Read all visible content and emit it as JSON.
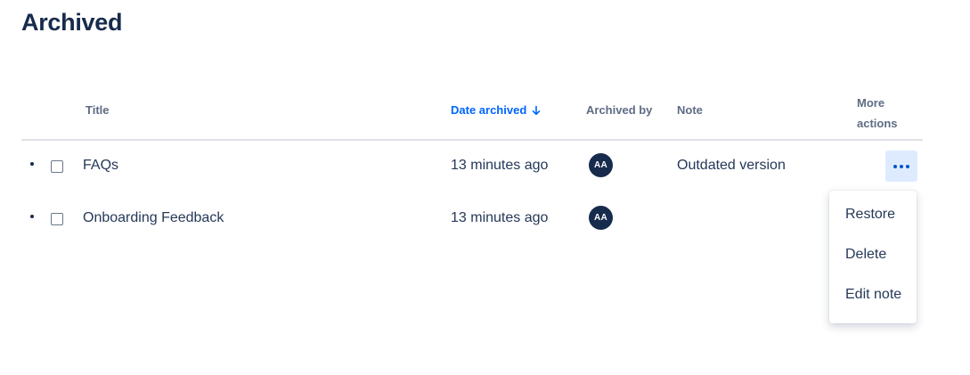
{
  "page": {
    "title": "Archived"
  },
  "table": {
    "headers": {
      "title": "Title",
      "date_archived": "Date archived",
      "archived_by": "Archived by",
      "note": "Note",
      "more_actions_line1": "More",
      "more_actions_line2": "actions"
    },
    "sort": {
      "column": "Date archived",
      "direction": "descending",
      "icon": "arrow-down-icon"
    },
    "rows": [
      {
        "title": "FAQs",
        "date": "13 minutes ago",
        "archived_by_initials": "AA",
        "note": "Outdated version"
      },
      {
        "title": "Onboarding Feedback",
        "date": "13 minutes ago",
        "archived_by_initials": "AA",
        "note": ""
      }
    ]
  },
  "menu": {
    "items": [
      "Restore",
      "Delete",
      "Edit note"
    ]
  },
  "colors": {
    "text": "#172b4d",
    "accent": "#0065ff",
    "more_button_bg": "#deebff",
    "avatar_bg": "#172b4d"
  }
}
